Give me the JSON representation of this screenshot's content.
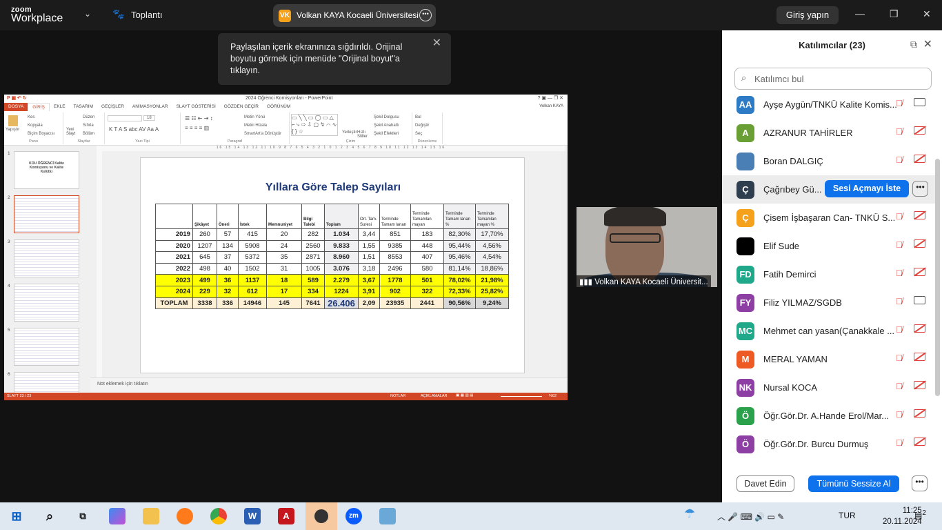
{
  "app": {
    "logo_line1": "zoom",
    "logo_line2": "Workplace",
    "meeting_label": "Toplantı",
    "signin": "Giriş yapın"
  },
  "host": {
    "initials": "VK",
    "name": "Volkan KAYA Kocaeli Üniversitesi",
    "color": "#f5a11c"
  },
  "toast": {
    "text": "Paylaşılan içerik ekranınıza sığdırıldı. Orijinal boyutu görmek için menüde \"Orijinal boyut\"a tıklayın."
  },
  "ppt": {
    "title": "2024 Öğrenci Komisyonları - PowerPoint",
    "user": "Volkan KAYA",
    "tabs": [
      "DOSYA",
      "GİRİŞ",
      "EKLE",
      "TASARIM",
      "GEÇİŞLER",
      "ANİMASYONLAR",
      "SLAYT GÖSTERİSİ",
      "GÖZDEN GEÇİR",
      "GÖRÜNÜM"
    ],
    "ribbon": {
      "pano": [
        "Yapıştır",
        "Kes",
        "Kopyala",
        "Biçim Boyacısı",
        "Pano"
      ],
      "slaytlar": [
        "Yeni Slayt",
        "Düzen",
        "Sıfırla",
        "Bölüm",
        "Slaytlar"
      ],
      "yazi_tipi": [
        "18",
        "Yazı Tipi"
      ],
      "paragraf": [
        "Metin Yönü",
        "Metni Hizala",
        "SmartArt'a Dönüştür",
        "Paragraf"
      ],
      "cizim": [
        "Yerleştir",
        "Hızlı Stiller",
        "Şekil Dolgusu",
        "Şekil Anahattı",
        "Şekil Efektleri",
        "Çizim"
      ],
      "duzenleme": [
        "Bul",
        "Değiştir",
        "Seç",
        "Düzenleme"
      ]
    },
    "thumb_numbers": [
      "1",
      "2",
      "3",
      "4",
      "5",
      "6"
    ],
    "thumb1_text": "KOU ÖĞRENCİ Kalite Komisyonu ve Kalite Kulübü",
    "notes_placeholder": "Not eklemek için tıklatın",
    "status": {
      "slide": "SLAYT 23 / 23",
      "notes": "NOTLAR",
      "comments": "AÇIKLAMALAR",
      "zoom": "%62"
    },
    "slide": {
      "title": "Yıllara Göre Talep Sayıları",
      "headers": [
        "",
        "Şikâyet",
        "Öneri",
        "İstek",
        "Memnuniyet",
        "Bilgi Talebi",
        "Toplam",
        "Ort. Tam. Suresi",
        "Terminde Tamam lanan",
        "Terminde Tamamlan mayan",
        "Terminde Tamam lanan %",
        "Terminde Tamamlan mayan %"
      ],
      "rows": [
        [
          "2019",
          "260",
          "57",
          "415",
          "20",
          "282",
          "1.034",
          "3,44",
          "851",
          "183",
          "82,30%",
          "17,70%"
        ],
        [
          "2020",
          "1207",
          "134",
          "5908",
          "24",
          "2560",
          "9.833",
          "1,55",
          "9385",
          "448",
          "95,44%",
          "4,56%"
        ],
        [
          "2021",
          "645",
          "37",
          "5372",
          "35",
          "2871",
          "8.960",
          "1,51",
          "8553",
          "407",
          "95,46%",
          "4,54%"
        ],
        [
          "2022",
          "498",
          "40",
          "1502",
          "31",
          "1005",
          "3.076",
          "3,18",
          "2496",
          "580",
          "81,14%",
          "18,86%"
        ],
        [
          "2023",
          "499",
          "36",
          "1137",
          "18",
          "589",
          "2.279",
          "3,67",
          "1778",
          "501",
          "78,02%",
          "21,98%"
        ],
        [
          "2024",
          "229",
          "32",
          "612",
          "17",
          "334",
          "1224",
          "3,91",
          "902",
          "322",
          "72,33%",
          "25,82%"
        ]
      ],
      "highlight_years": [
        "2023",
        "2024"
      ],
      "total": [
        "TOPLAM",
        "3338",
        "336",
        "14946",
        "145",
        "7641",
        "26.406",
        "2,09",
        "23935",
        "2441",
        "90,56%",
        "9,24%"
      ]
    }
  },
  "video": {
    "label": "Volkan KAYA Kocaeli Üniversit..."
  },
  "panel": {
    "title": "Katılımcılar (23)",
    "search_placeholder": "Katılımcı bul",
    "request_unmute": "Sesi Açmayı İste",
    "invite": "Davet Edin",
    "mute_all": "Tümünü Sessize Al",
    "participants": [
      {
        "initials": "AA",
        "name": "Ayşe Aygün/TNKÜ Kalite Komis...",
        "color": "#2d7bc4",
        "video": "on"
      },
      {
        "initials": "A",
        "name": "AZRANUR TAHİRLER",
        "color": "#6a9f35",
        "video": "off"
      },
      {
        "initials": "",
        "name": "Boran DALGIÇ",
        "color": "#4a7fb5",
        "video": "off"
      },
      {
        "initials": "Ç",
        "name": "Çağrıbey Gü...",
        "color": "#2f3e4e",
        "video": "hover"
      },
      {
        "initials": "Ç",
        "name": "Çisem İşbaşaran Can- TNKÜ S...",
        "color": "#f5a11c",
        "video": "off"
      },
      {
        "initials": "",
        "name": "Elif Sude",
        "color": "#000000",
        "video": "off"
      },
      {
        "initials": "FD",
        "name": "Fatih Demirci",
        "color": "#1fa88a",
        "video": "off"
      },
      {
        "initials": "FY",
        "name": "Filiz YILMAZ/SGDB",
        "color": "#8e3fa3",
        "video": "on"
      },
      {
        "initials": "MC",
        "name": "Mehmet can yasan(Çanakkale ...",
        "color": "#1fa88a",
        "video": "off"
      },
      {
        "initials": "M",
        "name": "MERAL YAMAN",
        "color": "#ee5a24",
        "video": "off"
      },
      {
        "initials": "NK",
        "name": "Nursal KOCA",
        "color": "#8e3fa3",
        "video": "off"
      },
      {
        "initials": "Ö",
        "name": "Öğr.Gör.Dr. A.Hande Erol/Mar...",
        "color": "#2aa14a",
        "video": "off"
      },
      {
        "initials": "Ö",
        "name": "Öğr.Gör.Dr. Burcu Durmuş",
        "color": "#8e3fa3",
        "video": "off"
      }
    ]
  },
  "taskbar": {
    "lang": "TUR",
    "time": "11:25",
    "date": "20.11.2024",
    "notifications": "2"
  }
}
